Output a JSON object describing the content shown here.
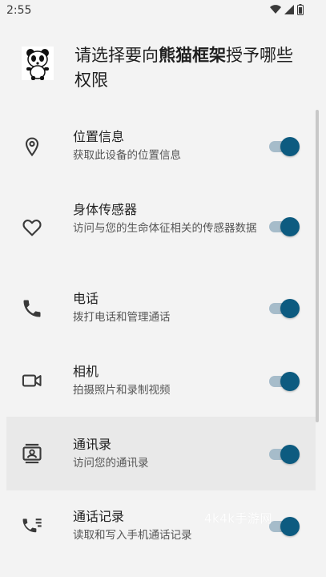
{
  "status_bar": {
    "time": "2:55"
  },
  "header": {
    "title_part1": "请选择要向",
    "title_app": "熊猫框架",
    "title_part2": "授予哪些权限"
  },
  "permissions": [
    {
      "title": "位置信息",
      "description": "获取此设备的位置信息",
      "icon": "location-icon",
      "enabled": true
    },
    {
      "title": "身体传感器",
      "description": "访问与您的生命体征相关的传感器数据",
      "icon": "heart-icon",
      "enabled": true
    },
    {
      "title": "电话",
      "description": "拨打电话和管理通话",
      "icon": "phone-icon",
      "enabled": true
    },
    {
      "title": "相机",
      "description": "拍摄照片和录制视频",
      "icon": "camera-icon",
      "enabled": true
    },
    {
      "title": "通讯录",
      "description": "访问您的通讯录",
      "icon": "contacts-icon",
      "enabled": true
    },
    {
      "title": "通话记录",
      "description": "读取和写入手机通话记录",
      "icon": "call-log-icon",
      "enabled": true
    }
  ],
  "watermark": "4k4k手游网",
  "colors": {
    "accent": "#0d5b80",
    "track": "#a6bcca",
    "background": "#f3f3f3"
  }
}
